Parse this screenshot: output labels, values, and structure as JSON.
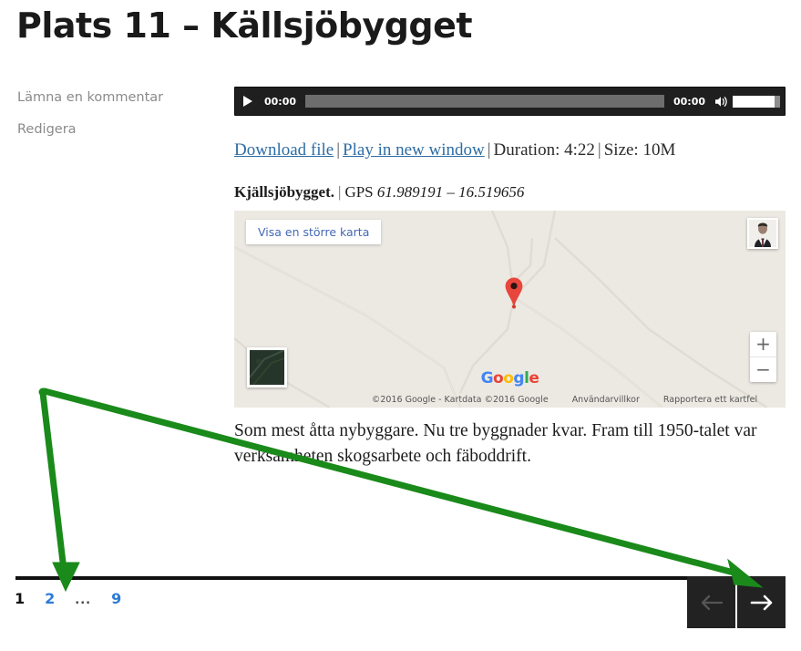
{
  "page": {
    "title": "Plats 11 – Källsjöbygget"
  },
  "meta": {
    "comment_link": "Lämna en kommentar",
    "edit_link": "Redigera"
  },
  "player": {
    "play_icon": "play-icon",
    "current_time": "00:00",
    "total_time": "00:00",
    "speaker_icon": "speaker-icon",
    "progress_percent": 0,
    "volume_percent": 88
  },
  "file_info": {
    "download_label": "Download file",
    "new_window_label": "Play in new window",
    "separator": "|",
    "duration_label": "Duration: 4:22",
    "size_label": "Size: 10M"
  },
  "caption": {
    "place": "Kjällsjöbygget.",
    "separator": "|",
    "gps_prefix": "GPS",
    "coordinates": "61.989191 – 16.519656"
  },
  "map": {
    "bigger_map_label": "Visa en större karta",
    "avatar_name": "profile-photo-thumbnail",
    "satellite_toggle_name": "satellite-view-thumbnail",
    "zoom_in_label": "+",
    "zoom_out_label": "−",
    "pin_name": "location-marker",
    "logo_letters": [
      "G",
      "o",
      "o",
      "g",
      "l",
      "e"
    ],
    "copyright": "©2016 Google - Kartdata ©2016 Google",
    "terms_label": "Användarvillkor",
    "report_label": "Rapportera ett kartfel",
    "background_color": "#ece9e3",
    "pin_color": "#e8453c"
  },
  "article": {
    "body": "Som mest åtta nybyggare. Nu tre byggnader kvar. Fram till 1950-talet var verksamheten skogsarbete och fäboddrift."
  },
  "pagination": {
    "items": [
      {
        "label": "1",
        "type": "current"
      },
      {
        "label": "2",
        "type": "link"
      },
      {
        "label": "...",
        "type": "dots"
      },
      {
        "label": "9",
        "type": "link"
      }
    ]
  },
  "nav": {
    "prev_icon": "arrow-left-icon",
    "next_icon": "arrow-right-icon"
  },
  "annotations": {
    "color": "#1a8a1a",
    "arrow_down_target": "pagination-page-2",
    "arrow_right_target": "next-page-button"
  }
}
